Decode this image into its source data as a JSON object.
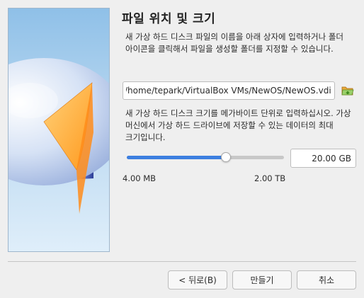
{
  "page_title": "파일 위치 및 크기",
  "location": {
    "description": "새 가상 하드 디스크 파일의 이름을 아래 상자에 입력하거나 폴더 아이콘을 클릭해서 파일을 생성할 폴더를 지정할 수 있습니다.",
    "path": "/home/tepark/VirtualBox VMs/NewOS/NewOS.vdi",
    "folder_icon": "folder-open-icon"
  },
  "size": {
    "description": "새 가상 하드 디스크 크기를 메가바이트 단위로 입력하십시오. 가상 머신에서 가상 하드 드라이브에 저장할 수 있는 데이터의 최대 크기입니다.",
    "value": "20.00 GB",
    "slider_fraction": 0.63,
    "min_label": "4.00 MB",
    "max_label": "2.00 TB"
  },
  "buttons": {
    "back": "< 뒤로(B)",
    "create": "만들기",
    "cancel": "취소"
  },
  "colors": {
    "accent": "#3d7fe0",
    "background": "#efefef"
  }
}
